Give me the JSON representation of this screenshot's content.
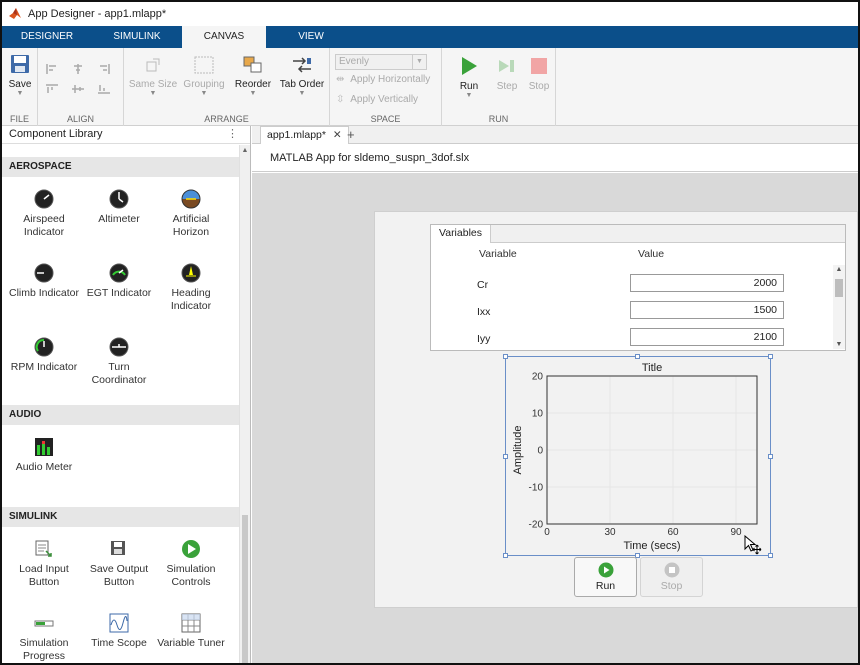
{
  "window": {
    "title": "App Designer - app1.mlapp*"
  },
  "tabs": [
    {
      "label": "DESIGNER",
      "active": false
    },
    {
      "label": "SIMULINK",
      "active": false
    },
    {
      "label": "CANVAS",
      "active": true
    },
    {
      "label": "VIEW",
      "active": false
    }
  ],
  "toolstrip": {
    "file": {
      "label": "FILE",
      "save": "Save"
    },
    "align": {
      "label": "ALIGN"
    },
    "arrange": {
      "label": "ARRANGE",
      "same_size": "Same Size",
      "grouping": "Grouping",
      "reorder": "Reorder",
      "tab_order": "Tab Order"
    },
    "space": {
      "label": "SPACE",
      "dropdown_value": "Evenly",
      "apply_h": "Apply Horizontally",
      "apply_v": "Apply Vertically"
    },
    "run": {
      "label": "RUN",
      "run": "Run",
      "step": "Step",
      "stop": "Stop"
    }
  },
  "library": {
    "title": "Component Library",
    "categories": [
      {
        "name": "AEROSPACE",
        "items": [
          "Airspeed Indicator",
          "Altimeter",
          "Artificial Horizon",
          "Climb Indicator",
          "EGT Indicator",
          "Heading Indicator",
          "RPM Indicator",
          "Turn Coordinator"
        ]
      },
      {
        "name": "AUDIO",
        "items": [
          "Audio Meter"
        ]
      },
      {
        "name": "SIMULINK",
        "items": [
          "Load Input Button",
          "Save Output Button",
          "Simulation Controls",
          "Simulation Progress",
          "Time Scope",
          "Variable Tuner"
        ]
      }
    ]
  },
  "editor": {
    "tab_label": "app1.mlapp*",
    "close_glyph": "✕",
    "add_glyph": "+",
    "doc_title": "MATLAB App for sldemo_suspn_3dof.slx"
  },
  "variables_panel": {
    "tab": "Variables",
    "col_variable": "Variable",
    "col_value": "Value",
    "rows": [
      {
        "name": "Cr",
        "value": "2000"
      },
      {
        "name": "Ixx",
        "value": "1500"
      },
      {
        "name": "Iyy",
        "value": "2100"
      }
    ]
  },
  "plot": {
    "title": "Title",
    "xlabel": "Time (secs)",
    "ylabel": "Amplitude",
    "xlim": [
      0,
      100
    ],
    "ylim": [
      -20,
      20
    ],
    "xticks": [
      "0",
      "30",
      "60",
      "90"
    ],
    "yticks": [
      "20",
      "10",
      "0",
      "-10",
      "-20"
    ]
  },
  "buttons": {
    "run": "Run",
    "stop": "Stop"
  },
  "colors": {
    "tabbar": "#0b4f8a",
    "run_green": "#3aa23a"
  }
}
